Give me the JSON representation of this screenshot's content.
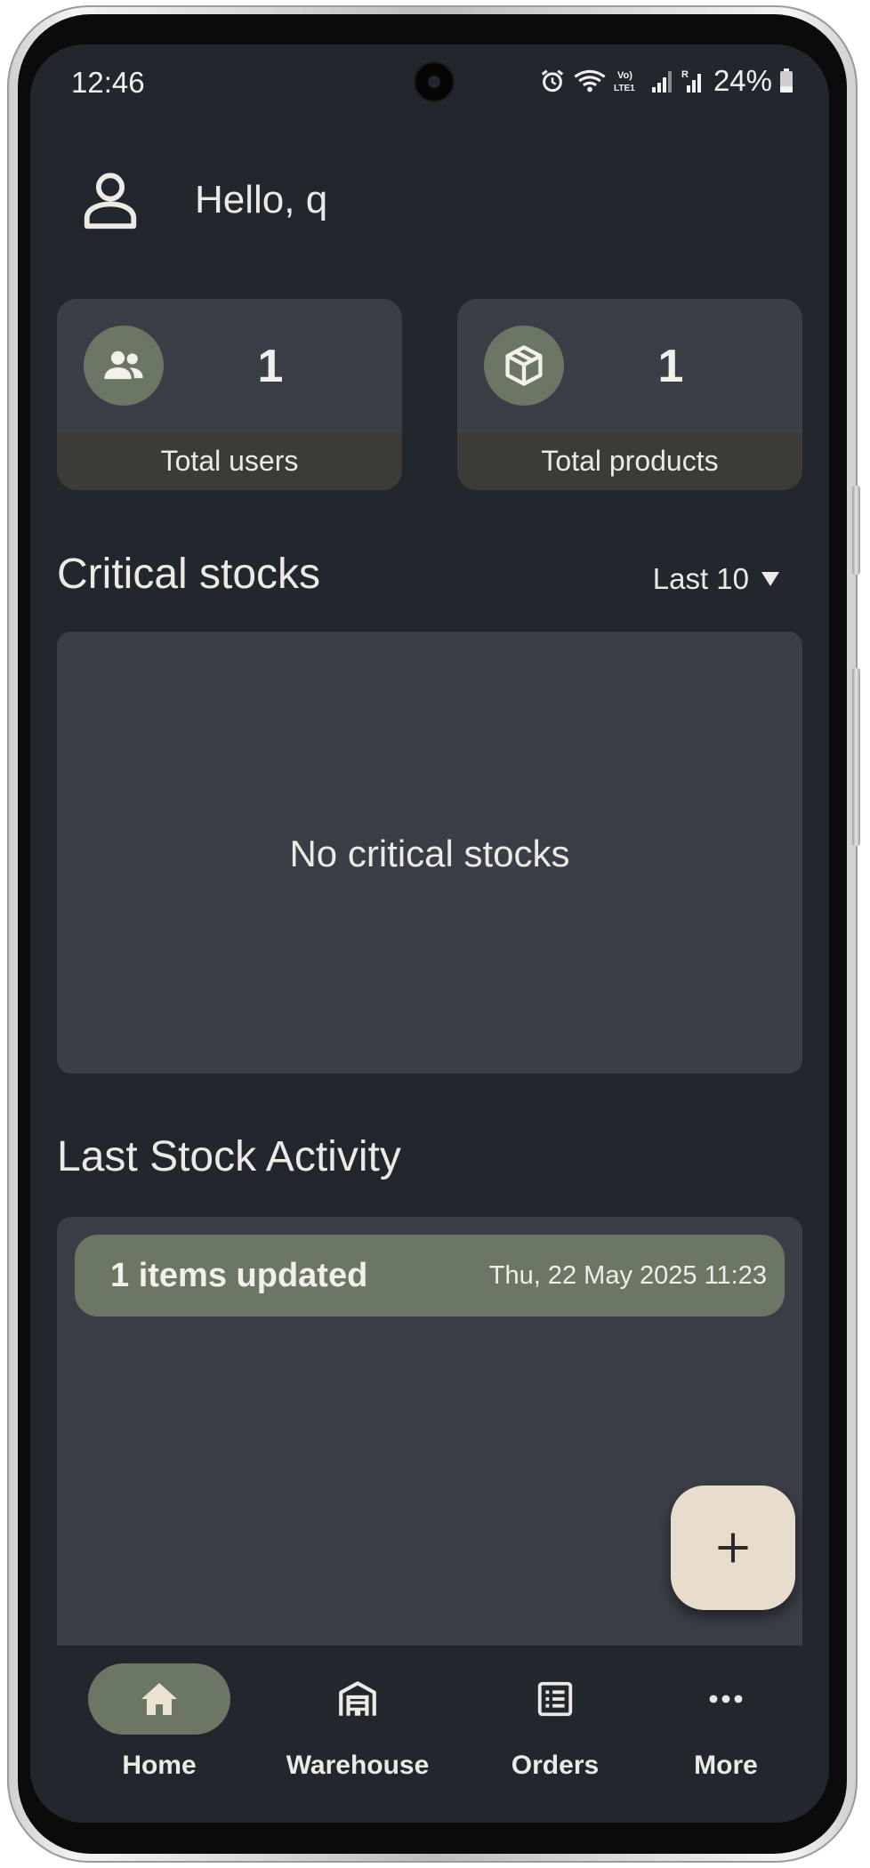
{
  "status_bar": {
    "time": "12:46",
    "battery": "24%",
    "icons": [
      "alarm-icon",
      "wifi-icon",
      "volte-icon",
      "signal-icon",
      "signal-roaming-icon",
      "battery-icon"
    ]
  },
  "header": {
    "greeting": "Hello, q",
    "avatar_icon": "user-icon"
  },
  "stats": [
    {
      "icon": "users-icon",
      "value": "1",
      "label": "Total users"
    },
    {
      "icon": "box-icon",
      "value": "1",
      "label": "Total products"
    }
  ],
  "critical_stocks": {
    "title": "Critical stocks",
    "filter_label": "Last 10",
    "empty_message": "No critical stocks"
  },
  "stock_activity": {
    "title": "Last Stock Activity",
    "items": [
      {
        "title": "1 items updated",
        "date": "Thu, 22 May 2025 11:23"
      }
    ]
  },
  "fab": {
    "icon": "plus-icon"
  },
  "bottom_nav": {
    "items": [
      {
        "label": "Home",
        "icon": "home-icon",
        "active": true
      },
      {
        "label": "Warehouse",
        "icon": "warehouse-icon",
        "active": false
      },
      {
        "label": "Orders",
        "icon": "orders-icon",
        "active": false
      },
      {
        "label": "More",
        "icon": "more-icon",
        "active": false
      }
    ]
  },
  "colors": {
    "background": "#22262d",
    "card": "#3a3e46",
    "accent": "#6b7665",
    "fab": "#e8dccd",
    "text": "#eceae4"
  }
}
